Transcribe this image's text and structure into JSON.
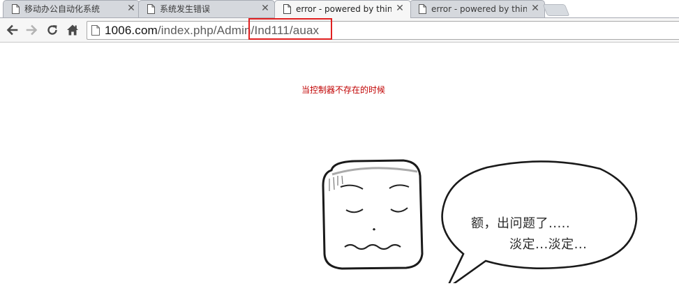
{
  "tabs": [
    {
      "title": "移动办公自动化系统",
      "active": false
    },
    {
      "title": "系统发生错误",
      "active": false
    },
    {
      "title": "error - powered by thinkphp",
      "active": true
    },
    {
      "title": "error - powered by thinkphp",
      "active": false
    }
  ],
  "icons": {
    "back": "arrow-left-icon",
    "forward": "arrow-right-icon",
    "reload": "reload-icon",
    "home": "home-icon",
    "page": "page-icon",
    "close": "close-icon"
  },
  "address_bar": {
    "host": "1006.com",
    "path": "/index.php/Admin/Ind111/auax"
  },
  "page": {
    "caption": "当控制器不存在的时候",
    "bubble_line1": "额，出问题了.....",
    "bubble_line2": "淡定...淡定..."
  },
  "colors": {
    "caption": "#c00000",
    "highlight": "#e02020",
    "tab_active": "#f6f6f6",
    "tab_inactive": "#d5d8dd"
  }
}
